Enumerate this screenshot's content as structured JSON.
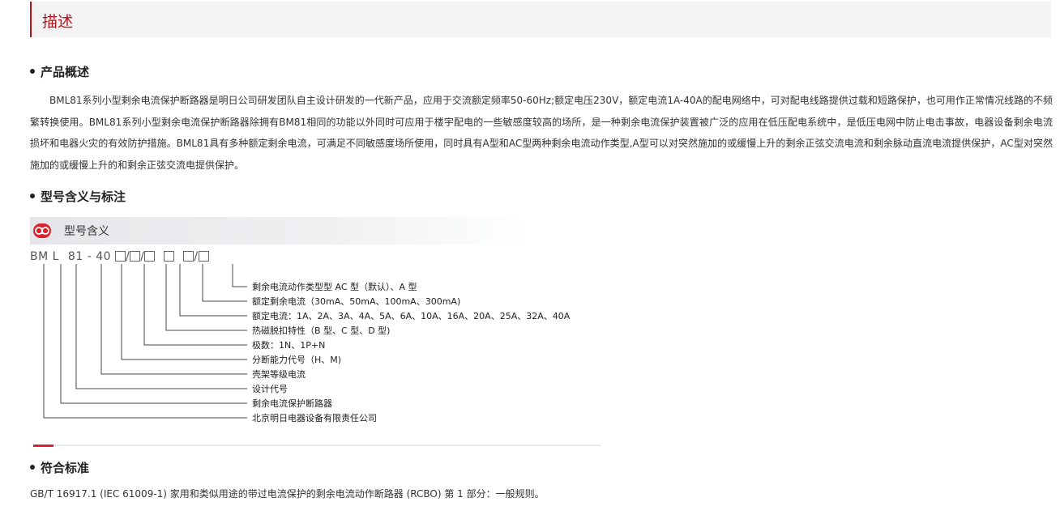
{
  "tab": {
    "title": "描述"
  },
  "overview": {
    "heading": "产品概述",
    "text": "BML81系列小型剩余电流保护断路器是明日公司研发团队自主设计研发的一代新产品，应用于交流额定频率50-60Hz;额定电压230V，额定电流1A-40A的配电网络中，可对配电线路提供过载和短路保护，也可用作正常情况线路的不频繁转换使用。BML81系列小型剩余电流保护断路器除拥有BM81相同的功能以外同时可应用于楼宇配电的一些敏感度较高的场所，是一种剩余电流保护装置被广泛的应用在低压配电系统中，是低压电网中防止电击事故，电器设备剩余电流损坏和电器火灾的有效防护措施。BML81具有多种额定剩余电流，可满足不同敏感度场所使用，同时具有A型和AC型两种剩余电流动作类型,A型可以对突然施加的或缓慢上升的剩余正弦交流电流和剩余脉动直流电流提供保护，AC型对突然施加的或缓慢上升的和剩余正弦交流电提供保护。"
  },
  "model": {
    "heading": "型号含义与标注",
    "diagram_title": "型号含义",
    "code_parts": [
      "BM",
      "L",
      "81",
      "-",
      "40"
    ],
    "separator": "/",
    "labels": [
      "剩余电流动作类型型 AC 型（默认）、A 型",
      "额定剩余电流（30mA、50mA、100mA、300mA)",
      "额定电流：1A、2A、3A、4A、5A、6A、10A、16A、20A、25A、32A、40A",
      "热磁脱扣特性（B 型、C 型、D 型)",
      "极数：1N、1P+N",
      "分断能力代号（H、M)",
      "壳架等级电流",
      "设计代号",
      "剩余电流保护断路器",
      "北京明日电器设备有限责任公司"
    ]
  },
  "standard": {
    "heading": "符合标准",
    "text": "GB/T 16917.1 (IEC 61009-1) 家用和类似用途的带过电流保护的剩余电流动作断路器 (RCBO) 第 1 部分：一般规则。"
  },
  "colors": {
    "accent": "#b8121b",
    "logo": "#d9232d"
  }
}
